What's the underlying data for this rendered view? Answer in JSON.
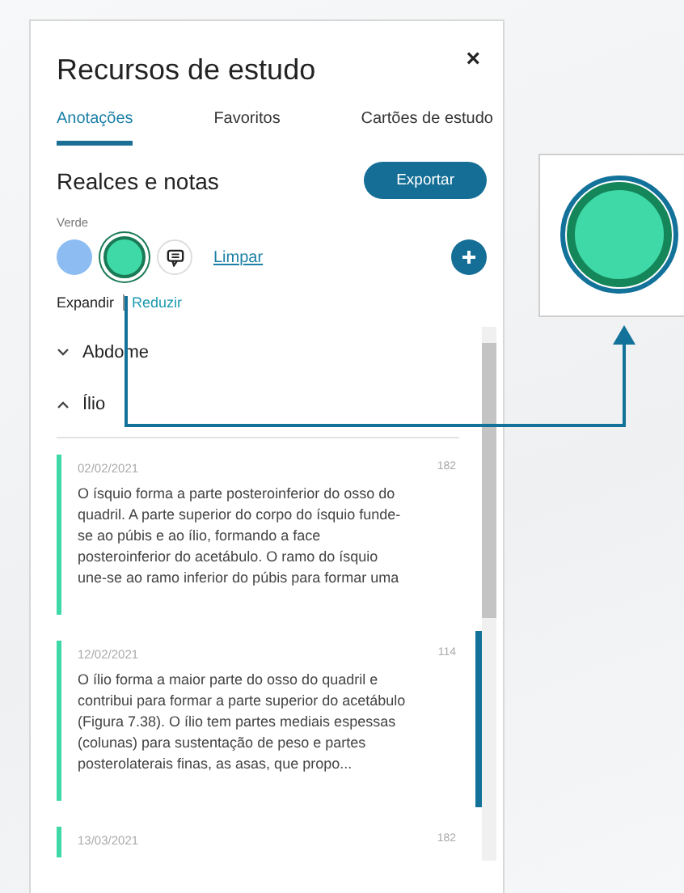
{
  "panel": {
    "title": "Recursos de estudo",
    "close": "×"
  },
  "tabs": [
    {
      "label": "Anotações",
      "selected": true
    },
    {
      "label": "Favoritos",
      "selected": false
    },
    {
      "label": "Cartões de estudo",
      "selected": false
    }
  ],
  "section": {
    "title": "Realces e notas",
    "export": "Exportar"
  },
  "color_label": "Verde",
  "swatches": [
    {
      "color": "#8cbcf2",
      "selected": false
    },
    {
      "color": "#3fd9a8",
      "selected": true
    }
  ],
  "clear_link": "Limpar",
  "expand": "Expandir",
  "collapse": "Reduzir",
  "groups": [
    {
      "label": "Abdome",
      "expanded": false
    },
    {
      "label": "Ílio",
      "expanded": true
    }
  ],
  "notes": [
    {
      "date": "02/02/2021",
      "page": "182",
      "color": "#3fd9a8",
      "selected": false,
      "text": "O ísquio forma a parte posteroinferior do osso do quadril. A parte superior do corpo do ísquio funde-se ao púbis e ao ílio, formando a face posteroinferior do acetábulo. O ramo do ísquio une-se ao ramo inferior do púbis para formar uma"
    },
    {
      "date": "12/02/2021",
      "page": "114",
      "color": "#3fd9a8",
      "selected": true,
      "text": "O ílio forma a maior parte do osso do quadril e contribui para formar a parte superior do acetábulo (Figura 7.38). O ílio tem partes mediais espessas (colunas) para sustentação de peso e partes posterolaterais finas, as asas, que propo..."
    },
    {
      "date": "13/03/2021",
      "page": "182",
      "color": "#3fd9a8",
      "selected": false
    }
  ]
}
